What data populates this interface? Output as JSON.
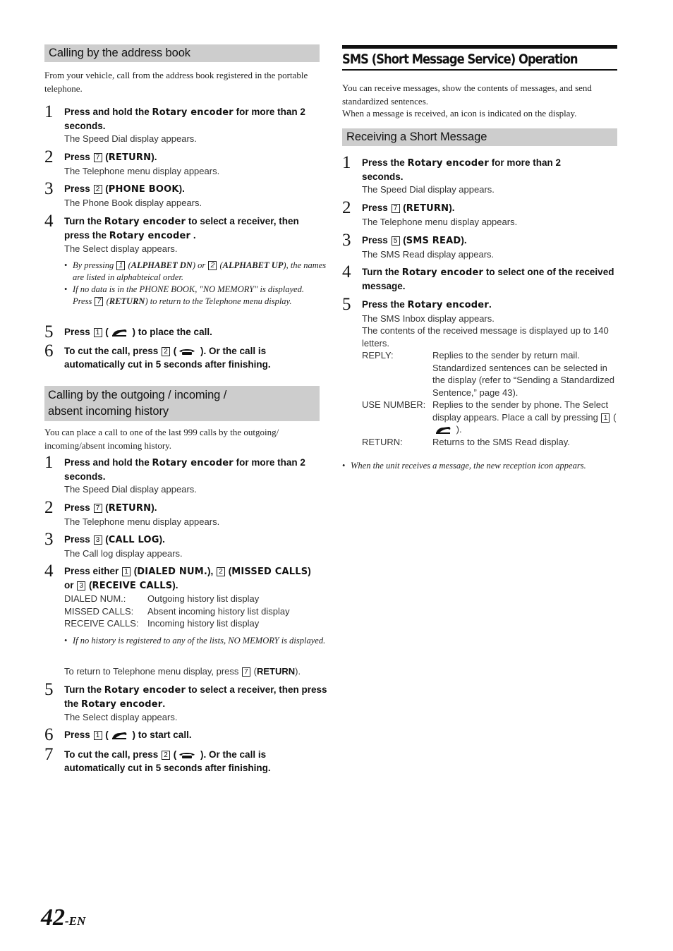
{
  "left": {
    "section1": {
      "heading": "Calling by the address book",
      "intro": "From your vehicle, call from the address book registered in the portable telephone.",
      "steps": [
        {
          "num": "1",
          "pre": "Press and hold the ",
          "kw": "Rotary encoder",
          "post": " for more than 2 seconds.",
          "desc": "The Speed Dial display appears."
        },
        {
          "num": "2",
          "pre": "Press ",
          "key": "7",
          "kwlabel": "RETURN",
          "desc": "The Telephone menu display appears."
        },
        {
          "num": "3",
          "pre": "Press ",
          "key": "2",
          "kwlabel": "PHONE BOOK",
          "desc": "The Phone Book display appears."
        },
        {
          "num": "4",
          "pre": "Turn the ",
          "kw": "Rotary encoder",
          "mid": "  to select a receiver, then press the ",
          "kw2": "Rotary encoder",
          "post": " .",
          "desc": "The Select display appears."
        },
        {
          "num": "5",
          "pre": "Press ",
          "key": "1",
          "post": " ) to place the call."
        },
        {
          "num": "6",
          "pre": "To cut the call, press ",
          "key": "2",
          "post": " ). Or the call is automatically cut in 5 seconds after finishing."
        }
      ],
      "notes": {
        "n1_pre": "By pressing ",
        "n1_key1": "1",
        "n1_l1": "ALPHABET DN",
        "n1_or": ") or ",
        "n1_key2": "2",
        "n1_l2": "ALPHABET UP",
        "n1_post": "), the names are listed in alphabteical order.",
        "n2": "If no data is in the PHONE BOOK, \"NO MEMORY\" is displayed.",
        "n2_pre": "Press ",
        "n2_key": "7",
        "n2_label": "RETURN",
        "n2_post": ") to return to the Telephone menu display."
      }
    },
    "section2": {
      "heading_line1": "Calling by the outgoing / incoming /",
      "heading_line2": "absent incoming history",
      "intro": "You can place a call to one of the last 999 calls by the outgoing/ incoming/absent incoming history.",
      "steps": [
        {
          "num": "1",
          "pre": "Press and hold the ",
          "kw": "Rotary encoder",
          "post": " for more than 2 seconds.",
          "desc": "The Speed Dial display appears."
        },
        {
          "num": "2",
          "pre": "Press ",
          "key": "7",
          "kwlabel": "RETURN",
          "desc": "The Telephone menu display appears."
        },
        {
          "num": "3",
          "pre": "Press ",
          "key": "3",
          "kwlabel": "CALL LOG",
          "desc": "The Call log display appears."
        },
        {
          "num": "4",
          "pre": "Press either ",
          "key1": "1",
          "l1": "DIALED NUM.",
          "key2": "2",
          "l2": "MISSED CALLS",
          "or": " or ",
          "key3": "3",
          "l3": "RECEIVE CALLS"
        },
        {
          "num": "5",
          "pre": "Turn the ",
          "kw": "Rotary encoder",
          "mid": " to select a receiver, then press the ",
          "kw2": "Rotary encoder",
          "post": ".",
          "desc": "The Select display appears."
        },
        {
          "num": "6",
          "pre": "Press ",
          "key": "1",
          "post": " ) to start call."
        },
        {
          "num": "7",
          "pre": "To cut the call, press ",
          "key": "2",
          "post": " ). Or the call is automatically cut in 5 seconds after finishing."
        }
      ],
      "definitions": [
        {
          "term": "DIALED NUM.:",
          "def": "Outgoing history list display"
        },
        {
          "term": "MISSED CALLS:",
          "def": "Absent incoming history list display"
        },
        {
          "term": "RECEIVE CALLS:",
          "def": "Incoming history list display"
        }
      ],
      "note": "If no history is registered to any of the lists, NO MEMORY is displayed.",
      "return_pre": "To return to Telephone menu display, press ",
      "return_key": "7",
      "return_label": "RETURN"
    }
  },
  "right": {
    "title": "SMS (Short Message Service) Operation",
    "intro1": "You can receive messages, show the contents of messages, and send standardized sentences.",
    "intro2": "When a message is received, an icon is indicated on the display.",
    "subheading": "Receiving a Short Message",
    "steps": [
      {
        "num": "1",
        "pre": "Press the ",
        "kw": "Rotary encoder",
        "post": " for more than 2 seconds.",
        "desc": "The Speed Dial display appears."
      },
      {
        "num": "2",
        "pre": "Press ",
        "key": "7",
        "kwlabel": "RETURN",
        "desc": "The Telephone menu display appears."
      },
      {
        "num": "3",
        "pre": "Press ",
        "key": "5",
        "kwlabel": "SMS READ",
        "desc": "The SMS Read display appears."
      },
      {
        "num": "4",
        "pre": "Turn the ",
        "kw": "Rotary encoder",
        "post": " to select one of the received message."
      },
      {
        "num": "5",
        "pre": "Press the ",
        "kw": "Rotary encoder",
        "post": ".",
        "desc": "The SMS Inbox display appears.",
        "desc2": "The contents of the received message is displayed up to 140 letters."
      }
    ],
    "definitions": [
      {
        "term": "REPLY:",
        "def": "Replies to the sender by return mail. Standardized sentences can be selected in the display (refer to “Sending a Standardized Sentence,” page 43)."
      },
      {
        "term": "USE NUMBER:",
        "def_pre": "Replies to the sender by phone.  The Select display appears. Place a call by pressing ",
        "key": "1",
        "def_post": " )."
      },
      {
        "term": "RETURN:",
        "def": "Returns to the SMS Read display."
      }
    ],
    "note": "When the unit receives a message, the new reception icon appears."
  },
  "footer": {
    "page_number": "42",
    "suffix": "-EN"
  },
  "icons": {
    "offhook": "phone-offhook-icon",
    "onhook": "phone-onhook-icon"
  }
}
